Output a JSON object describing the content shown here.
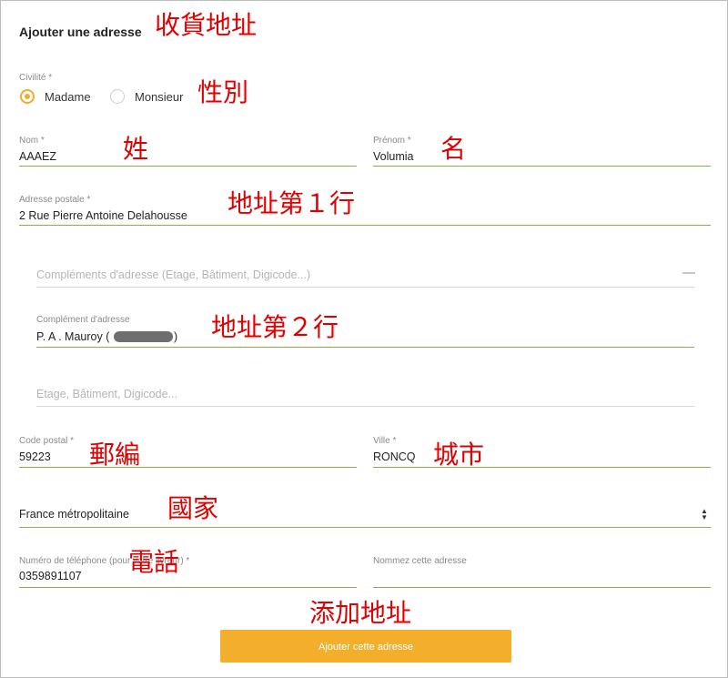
{
  "form": {
    "title": "Ajouter une adresse",
    "civility_label": "Civilité *",
    "civility_options": [
      "Madame",
      "Monsieur"
    ],
    "civility_selected": "Madame",
    "lastname_label": "Nom *",
    "lastname_value": "AAAEZ",
    "firstname_label": "Prénom *",
    "firstname_value": "Volumia",
    "address_label": "Adresse postale *",
    "address_value": "2 Rue Pierre Antoine Delahousse",
    "address_complement_placeholder": "Compléments d'adresse (Etage, Bâtiment, Digicode...)",
    "complement_label": "Complément d'adresse",
    "complement_value": "P. A . Mauroy  (",
    "complement_value_tail": ")",
    "building_placeholder": "Etage, Bâtiment, Digicode...",
    "postal_label": "Code postal *",
    "postal_value": "59223",
    "city_label": "Ville *",
    "city_value": "RONCQ",
    "country_value": "France métropolitaine",
    "phone_label": "Numéro de téléphone (pour votre livreur) *",
    "phone_value": "0359891107",
    "address_name_label": "Nommez cette adresse",
    "submit_label": "Ajouter cette adresse"
  },
  "annotations": {
    "title": "收貨地址",
    "civility": "性別",
    "lastname": "姓",
    "firstname": "名",
    "address1": "地址第１行",
    "address2": "地址第２行",
    "postal": "郵編",
    "city": "城市",
    "country": "國家",
    "phone": "電話",
    "submit": "添加地址"
  },
  "colors": {
    "accent": "#f3ae2b",
    "underline": "#8ab04a",
    "annotation": "#e00000"
  }
}
